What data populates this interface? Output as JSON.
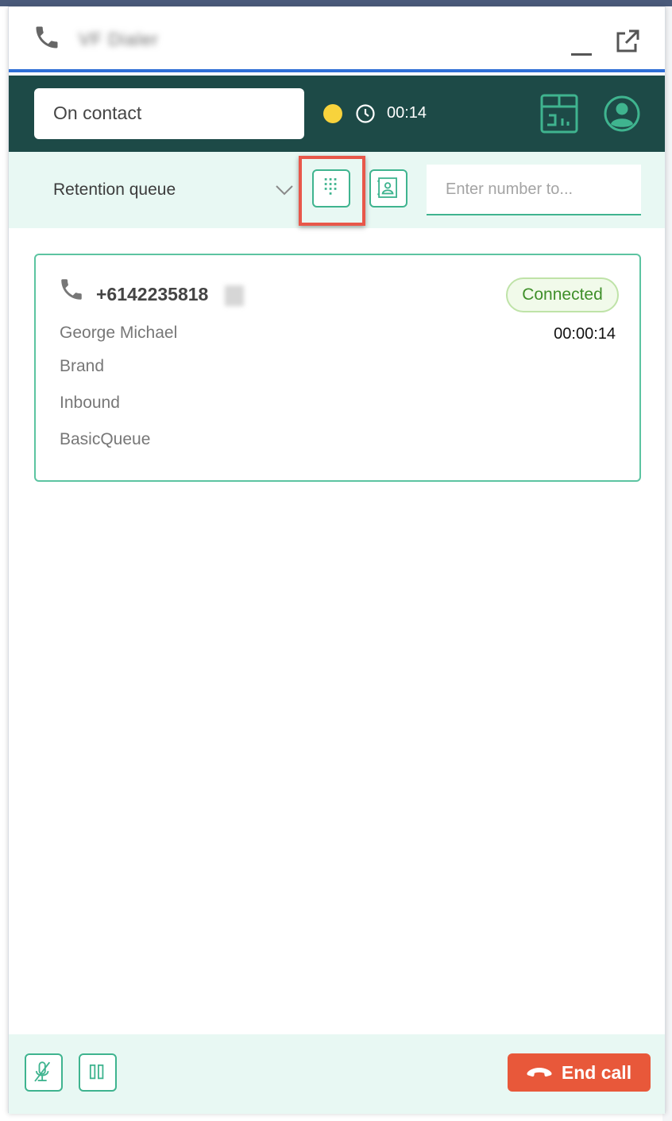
{
  "title": {
    "text": "VF Dialer"
  },
  "status": {
    "state": "On contact",
    "timer": "00:14",
    "dot_color": "#f8d33c"
  },
  "queue": {
    "selected": "Retention queue",
    "number_placeholder": "Enter number to..."
  },
  "contact": {
    "number": "+6142235818",
    "badge": "Connected",
    "duration": "00:00:14",
    "name": "George Michael",
    "brand": "Brand",
    "direction": "Inbound",
    "queue": "BasicQueue"
  },
  "footer": {
    "end_call_label": "End call"
  },
  "colors": {
    "header_bg": "#1d4a47",
    "accent": "#3fb48f",
    "end_call": "#e8583a",
    "highlight": "#e8574a"
  }
}
